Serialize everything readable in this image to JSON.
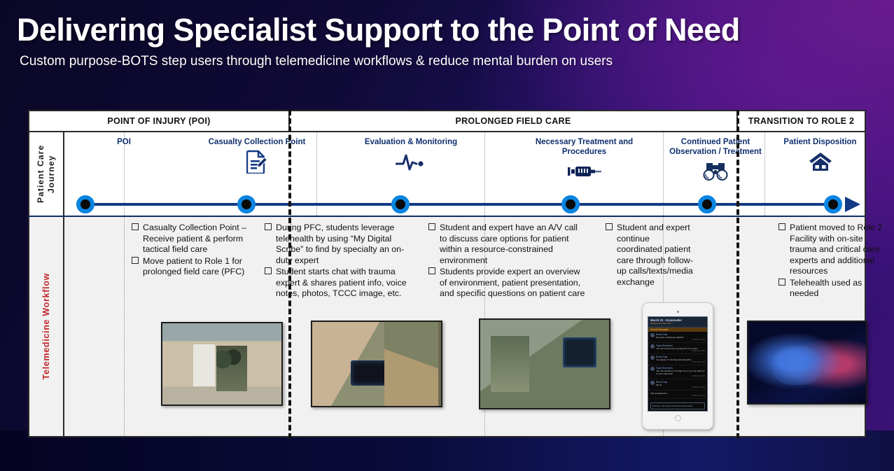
{
  "title": {
    "main": "Delivering Specialist Support to the Point of Need",
    "subtitle": "Custom purpose-BOTS step users through telemedicine workflows & reduce mental burden on users"
  },
  "colors": {
    "accent_blue": "#0b84e0",
    "timeline_blue": "#123a85",
    "stage_title": "#103070",
    "row_label_red": "#c1272d",
    "panel_bg": "#f1f1f1"
  },
  "phases": [
    {
      "label": "POINT OF INJURY (POI)"
    },
    {
      "label": "PROLONGED FIELD CARE"
    },
    {
      "label": "TRANSITION TO ROLE 2"
    }
  ],
  "rows": {
    "journey_label": "Patient Care Journey",
    "workflow_label": "Telemedicine Workflow"
  },
  "stages": [
    {
      "title": "POI",
      "icon": "none"
    },
    {
      "title": "Casualty Collection Point",
      "icon": "document-pencil-icon"
    },
    {
      "title": "Evaluation & Monitoring",
      "icon": "heartbeat-icon"
    },
    {
      "title": "Necessary Treatment and Procedures",
      "icon": "syringe-icon"
    },
    {
      "title": "Continued Patient Observation / Treatment",
      "icon": "binoculars-icon"
    },
    {
      "title": "Patient Disposition",
      "icon": "house-icon"
    }
  ],
  "workflow": [
    {
      "bullets": []
    },
    {
      "bullets": [
        "Casualty Collection Point – Receive patient & perform tactical field care",
        "Move patient to Role 1 for prolonged field care (PFC)"
      ],
      "media": "photo-casualty-collection"
    },
    {
      "bullets": [
        "During PFC, students leverage telehealth by using “My Digital Scribe” to find by specialty an on-duty expert",
        "Student starts chat with trauma expert & shares patient info, voice notes, photos, TCCC image, etc."
      ],
      "media": "photo-soldiers-tablet"
    },
    {
      "bullets": [
        "Student and expert have an A/V call to discuss care options for patient within a resource-constrained environment",
        "Students provide expert an overview of environment, patient presentation, and specific questions on patient care"
      ],
      "media": "photo-av-call"
    },
    {
      "bullets": [
        "Student and expert continue coordinated patient care through follow-up calls/texts/media exchange"
      ],
      "media": "tablet-chat-mockup"
    },
    {
      "bullets": [
        "Patient moved to Role 2 Facility with on-site trauma and critical care experts and additional resources",
        "Telehealth used as needed"
      ],
      "media": "photo-night-treatment"
    }
  ],
  "tablet_chat": {
    "header_title": "March 23 - Gunpowder",
    "header_sub": "Tap here for room info",
    "banner": "Unread Messages",
    "messages": [
      {
        "who": "Brook Gray",
        "text": "So many missing up patients",
        "time": "10:08 (dev, 203)"
      },
      {
        "who": "Taylor Bremsters",
        "text": "You can send some my way if it's too much",
        "time": "10:08 (dev, 203)"
      },
      {
        "who": "Brook Gray",
        "text": "Yes please I'm hurting and doing this",
        "time": "10:07 (dev, 203)"
      },
      {
        "who": "Taylor Bremsters",
        "text": "You can tell them to contact me or you can add me to your chat room",
        "time": "10:08 (dev, 203)"
      },
      {
        "who": "Brook Gray",
        "text": "Ok ok",
        "time": "10:08 (dev, 203)"
      },
      {
        "who": "",
        "text": "This is awesome!",
        "time": "10:08 (dev, 203)"
      }
    ],
    "expire_note": "Expires in 30 Days 14 Minutes 40 Seconds"
  }
}
